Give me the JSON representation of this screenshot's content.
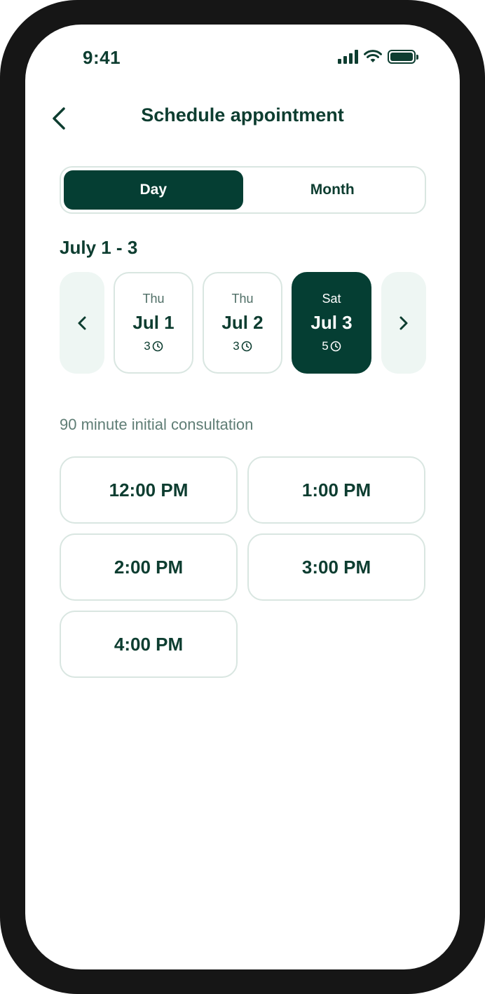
{
  "status_bar": {
    "time": "9:41"
  },
  "header": {
    "title": "Schedule appointment"
  },
  "view_toggle": {
    "options": [
      "Day",
      "Month"
    ],
    "selected": "Day"
  },
  "date_range": "July 1 - 3",
  "days": [
    {
      "weekday": "Thu",
      "date": "Jul 1",
      "slots": "3",
      "selected": false
    },
    {
      "weekday": "Thu",
      "date": "Jul 2",
      "slots": "3",
      "selected": false
    },
    {
      "weekday": "Sat",
      "date": "Jul 3",
      "slots": "5",
      "selected": true
    }
  ],
  "appointment_type": "90 minute initial consultation",
  "time_slots": [
    "12:00 PM",
    "1:00 PM",
    "2:00 PM",
    "3:00 PM",
    "4:00 PM"
  ],
  "colors": {
    "primary": "#053e33",
    "text": "#0d3d30",
    "border": "#d9e6e1",
    "arrow_bg": "#eef6f3"
  }
}
